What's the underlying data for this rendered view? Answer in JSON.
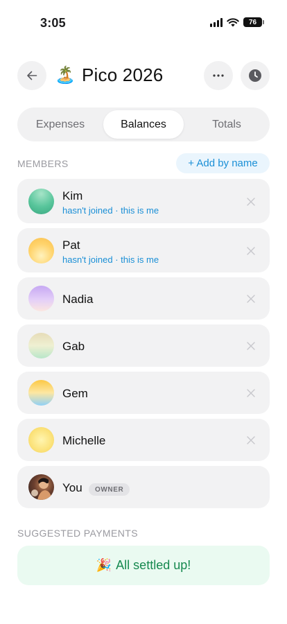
{
  "status_bar": {
    "time": "3:05",
    "battery": "76"
  },
  "header": {
    "trip_emoji": "🏝️",
    "title": "Pico 2026"
  },
  "tabs": [
    {
      "label": "Expenses",
      "active": false
    },
    {
      "label": "Balances",
      "active": true
    },
    {
      "label": "Totals",
      "active": false
    }
  ],
  "members_section": {
    "label": "MEMBERS",
    "add_button": "+ Add by name",
    "members": [
      {
        "name": "Kim",
        "subtitle": "hasn't joined · this is me"
      },
      {
        "name": "Pat",
        "subtitle": "hasn't joined · this is me"
      },
      {
        "name": "Nadia"
      },
      {
        "name": "Gab"
      },
      {
        "name": "Gem"
      },
      {
        "name": "Michelle"
      },
      {
        "name": "You",
        "badge": "OWNER"
      }
    ]
  },
  "payments_section": {
    "label": "SUGGESTED PAYMENTS",
    "settled_emoji": "🎉",
    "settled_text": "All settled up!"
  },
  "colors": {
    "accent_blue": "#1a8fd6",
    "settled_green": "#16894f",
    "settled_bg": "#eafaf1",
    "card_bg": "#f2f2f3"
  },
  "icons": {
    "back": "arrow-left-icon",
    "more": "more-horizontal-icon",
    "history": "clock-icon",
    "remove": "close-icon"
  }
}
